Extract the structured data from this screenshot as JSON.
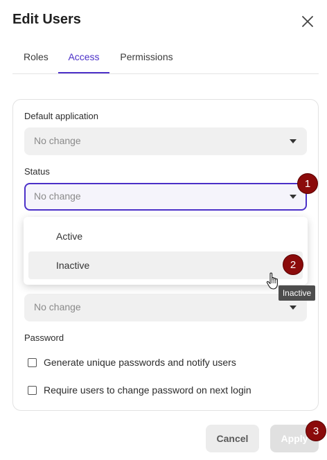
{
  "dialog": {
    "title": "Edit Users"
  },
  "tabs": [
    {
      "label": "Roles",
      "active": false
    },
    {
      "label": "Access",
      "active": true
    },
    {
      "label": "Permissions",
      "active": false
    }
  ],
  "fields": {
    "default_application": {
      "label": "Default application",
      "value": "No change"
    },
    "status": {
      "label": "Status",
      "value": "No change"
    },
    "third": {
      "value": "No change"
    },
    "password_label": "Password"
  },
  "status_dropdown": {
    "options": [
      "Active",
      "Inactive"
    ],
    "hovered": "Inactive"
  },
  "tooltip": "Inactive",
  "checkboxes": [
    {
      "label": "Generate unique passwords and notify users",
      "checked": false
    },
    {
      "label": "Require users to change password on next login",
      "checked": false
    }
  ],
  "buttons": {
    "cancel": "Cancel",
    "apply": "Apply"
  },
  "steps": [
    "1",
    "2",
    "3"
  ],
  "colors": {
    "accent": "#4b30c8",
    "badge": "#8b0b0b"
  },
  "icons": [
    "close-icon",
    "chevron-down-icon",
    "pointer-cursor-icon"
  ]
}
